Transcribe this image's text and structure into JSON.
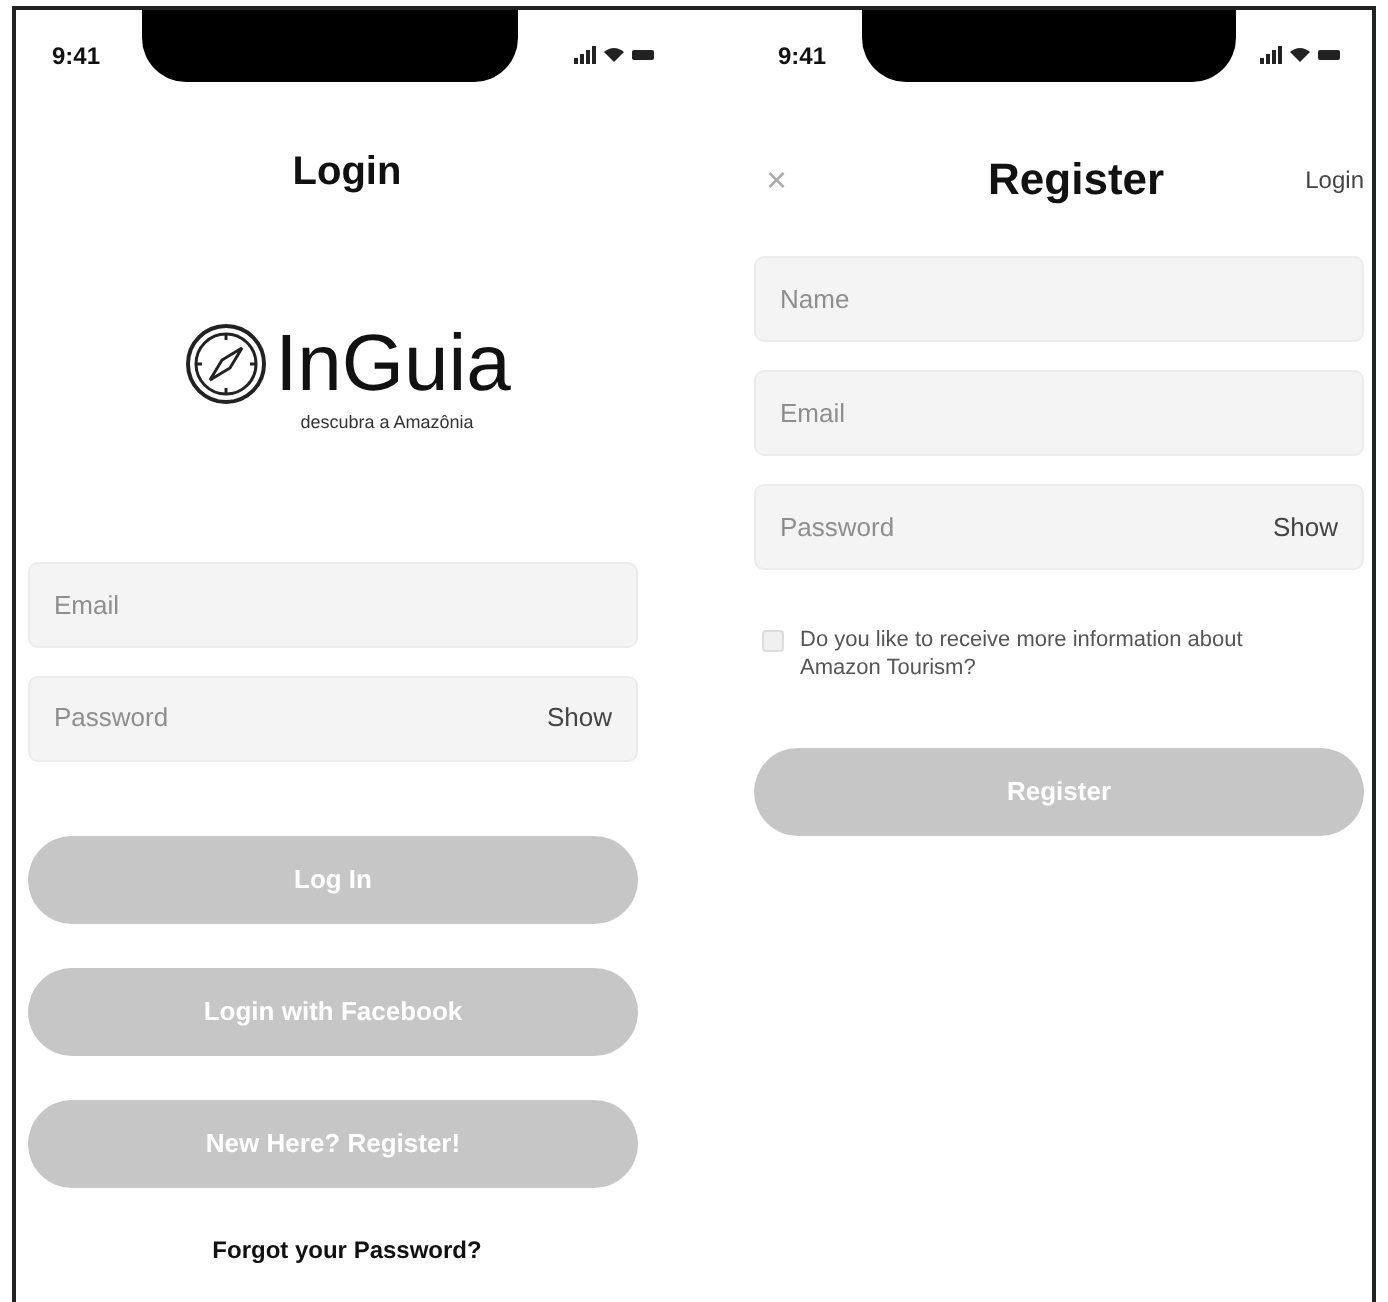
{
  "login": {
    "status_bar": {
      "time": "9:41"
    },
    "title": "Login",
    "logo": {
      "name": "InGuia",
      "tagline": "descubra a Amazônia"
    },
    "fields": [
      {
        "placeholder": "Email"
      },
      {
        "placeholder": "Password",
        "action": "Show"
      }
    ],
    "buttons": [
      "Log In",
      "Login with Facebook",
      "New Here? Register!"
    ],
    "forgot_link": "Forgot your Password?"
  },
  "register": {
    "status_bar": {
      "time": "9:41"
    },
    "close": "×",
    "title": "Register",
    "login_link": "Login",
    "fields": [
      {
        "placeholder": "Name"
      },
      {
        "placeholder": "Email"
      },
      {
        "placeholder": "Password",
        "action": "Show"
      }
    ],
    "checkbox": {
      "label": "Do you like to receive more information about Amazon Tourism?",
      "checked": false
    },
    "button": "Register"
  }
}
